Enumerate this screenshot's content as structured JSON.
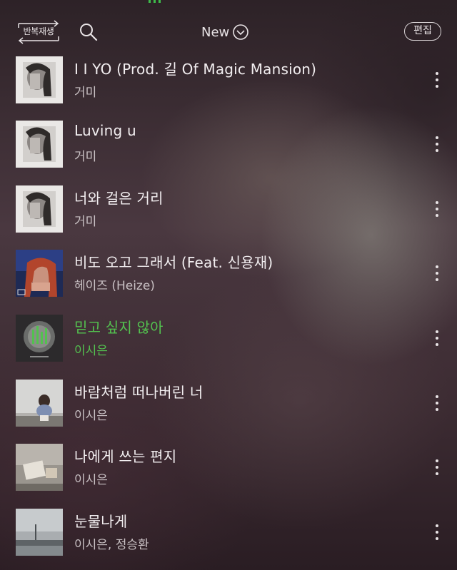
{
  "header": {
    "repeat_label": "반복재생",
    "sort_label": "New",
    "edit_label": "편집"
  },
  "icons": {
    "search": "search-icon",
    "sort_toggle": "chevron-down-circle-icon",
    "more": "more-vertical-icon",
    "repeat": "repeat-arrows-icon"
  },
  "colors": {
    "accent": "#53c14f",
    "text": "#f2eef0",
    "subtext": "#c9c1c4"
  },
  "songs": [
    {
      "title": "I I YO (Prod. 길 Of Magic Mansion)",
      "artist": "거미",
      "active": false
    },
    {
      "title": "Luving u",
      "artist": "거미",
      "active": false
    },
    {
      "title": "너와 걸은 거리",
      "artist": "거미",
      "active": false
    },
    {
      "title": "비도 오고 그래서 (Feat. 신용재)",
      "artist": "헤이즈 (Heize)",
      "active": false
    },
    {
      "title": "믿고 싶지 않아",
      "artist": "이시은",
      "active": true
    },
    {
      "title": "바람처럼 떠나버린 너",
      "artist": "이시은",
      "active": false
    },
    {
      "title": "나에게 쓰는 편지",
      "artist": "이시은",
      "active": false
    },
    {
      "title": "눈물나게",
      "artist": "이시은, 정승환",
      "active": false
    }
  ]
}
